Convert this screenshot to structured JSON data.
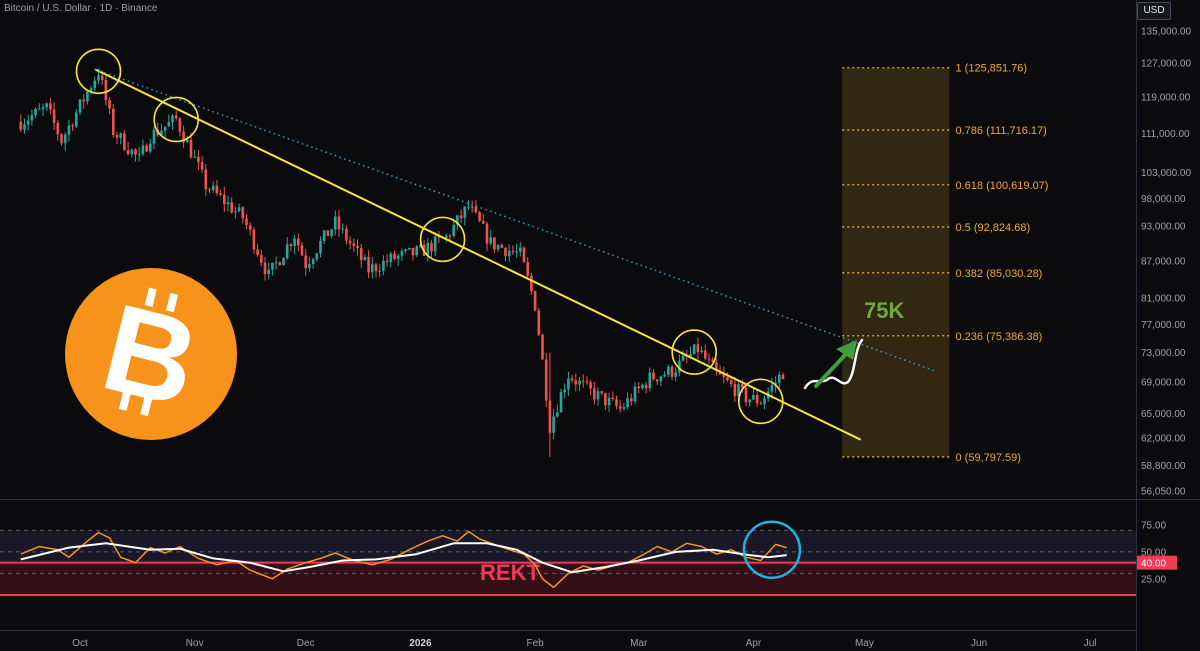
{
  "header": {
    "title": "Bitcoin / U.S. Dollar · 1D · Binance",
    "currency": "USD"
  },
  "colors": {
    "bull": "#26a69a",
    "bear": "#ef5350",
    "trend": "#f7e440",
    "dotted": "#2f9fc4",
    "fib": "#f0a92a",
    "rsi": "#f7931a",
    "rsi_ma": "#ffffff",
    "target": "#6fa93a",
    "bitcoin": "#f7931a"
  },
  "chart_data": [
    {
      "type": "candlestick",
      "title": "Bitcoin / U.S. Dollar · 1D · Binance",
      "y_axis_ticks": [
        "135,000.00",
        "127,000.00",
        "119,000.00",
        "111,000.00",
        "103,000.00",
        "98,000.00",
        "93,000.00",
        "87,000.00",
        "81,000.00",
        "77,000.00",
        "73,000.00",
        "69,000.00",
        "65,000.00",
        "62,000.00",
        "58,800.00",
        "56,050.00"
      ],
      "x_axis_ticks": [
        "Oct",
        "Nov",
        "Dec",
        "2026",
        "Feb",
        "Mar",
        "Apr",
        "May",
        "Jun",
        "Jul"
      ],
      "log_scale": true,
      "ylim": [
        54500,
        140000
      ],
      "price_path": [
        [
          "2025-09-15",
          113500
        ],
        [
          "2025-09-22",
          116500
        ],
        [
          "2025-09-26",
          109500
        ],
        [
          "2025-10-01",
          117000
        ],
        [
          "2025-10-06",
          125000
        ],
        [
          "2025-10-10",
          111500
        ],
        [
          "2025-10-17",
          105500
        ],
        [
          "2025-10-20",
          110500
        ],
        [
          "2025-10-27",
          114000
        ],
        [
          "2025-11-04",
          100500
        ],
        [
          "2025-11-14",
          94500
        ],
        [
          "2025-11-21",
          84500
        ],
        [
          "2025-11-28",
          91500
        ],
        [
          "2025-12-01",
          86500
        ],
        [
          "2025-12-09",
          93500
        ],
        [
          "2025-12-18",
          85500
        ],
        [
          "2025-12-25",
          87500
        ],
        [
          "2026-01-01",
          88500
        ],
        [
          "2026-01-08",
          91000
        ],
        [
          "2026-01-14",
          96500
        ],
        [
          "2026-01-20",
          90000
        ],
        [
          "2026-01-28",
          88000
        ],
        [
          "2026-02-01",
          80000
        ],
        [
          "2026-02-05",
          63500
        ],
        [
          "2026-02-10",
          70000
        ],
        [
          "2026-02-15",
          68000
        ],
        [
          "2026-02-24",
          65500
        ],
        [
          "2026-03-04",
          69500
        ],
        [
          "2026-03-10",
          70500
        ],
        [
          "2026-03-17",
          73500
        ],
        [
          "2026-03-22",
          70000
        ],
        [
          "2026-03-30",
          67000
        ],
        [
          "2026-04-03",
          66500
        ],
        [
          "2026-04-07",
          69000
        ],
        [
          "2026-04-10",
          71000
        ]
      ],
      "circled_touch_points": [
        "2025-10-06",
        "2025-10-27",
        "2026-01-07",
        "2026-03-16",
        "2026-04-03"
      ],
      "trendlines": [
        {
          "style": "solid",
          "from": [
            "2025-10-05",
            125500
          ],
          "to": [
            "2026-04-30",
            61800
          ]
        },
        {
          "style": "dotted",
          "from": [
            "2025-10-05",
            125500
          ],
          "to": [
            "2026-05-20",
            70500
          ]
        }
      ],
      "fibonacci": {
        "levels": [
          {
            "label": "1 (125,851.76)",
            "value": 125851.76
          },
          {
            "label": "0.786 (111,716.17)",
            "value": 111716.17
          },
          {
            "label": "0.618 (100,619.07)",
            "value": 100619.07
          },
          {
            "label": "0.5 (92,824.68)",
            "value": 92824.68
          },
          {
            "label": "0.382 (85,030.28)",
            "value": 85030.28
          },
          {
            "label": "0.236 (75,386.38)",
            "value": 75386.38
          },
          {
            "label": "0 (59,797.59)",
            "value": 59797.59
          }
        ],
        "x_range": [
          "2026-04-25",
          "2026-05-24"
        ]
      },
      "annotation": {
        "text": "75K",
        "value": 75000
      }
    },
    {
      "type": "line",
      "name": "RSI",
      "y_axis_ticks": [
        "75.00",
        "50.00",
        "25.00"
      ],
      "ylim": [
        5,
        85
      ],
      "bands": [
        70,
        30
      ],
      "highlight_value": 40,
      "highlight_label": "40.00",
      "rekt_zone": [
        10,
        40
      ],
      "zone_label": "REKT",
      "rsi_path": [
        [
          "2025-09-15",
          48
        ],
        [
          "2025-09-20",
          55
        ],
        [
          "2025-09-25",
          52
        ],
        [
          "2025-09-28",
          45
        ],
        [
          "2025-10-03",
          60
        ],
        [
          "2025-10-06",
          68
        ],
        [
          "2025-10-09",
          63
        ],
        [
          "2025-10-12",
          45
        ],
        [
          "2025-10-16",
          40
        ],
        [
          "2025-10-20",
          54
        ],
        [
          "2025-10-24",
          49
        ],
        [
          "2025-10-28",
          55
        ],
        [
          "2025-11-02",
          44
        ],
        [
          "2025-11-07",
          38
        ],
        [
          "2025-11-12",
          42
        ],
        [
          "2025-11-16",
          33
        ],
        [
          "2025-11-19",
          29
        ],
        [
          "2025-11-22",
          25
        ],
        [
          "2025-11-26",
          34
        ],
        [
          "2025-12-01",
          40
        ],
        [
          "2025-12-05",
          44
        ],
        [
          "2025-12-09",
          49
        ],
        [
          "2025-12-14",
          42
        ],
        [
          "2025-12-19",
          38
        ],
        [
          "2025-12-24",
          43
        ],
        [
          "2025-12-29",
          52
        ],
        [
          "2026-01-03",
          60
        ],
        [
          "2026-01-07",
          65
        ],
        [
          "2026-01-11",
          60
        ],
        [
          "2026-01-14",
          69
        ],
        [
          "2026-01-17",
          62
        ],
        [
          "2026-01-21",
          57
        ],
        [
          "2026-01-25",
          52
        ],
        [
          "2026-01-29",
          48
        ],
        [
          "2026-02-01",
          38
        ],
        [
          "2026-02-03",
          25
        ],
        [
          "2026-02-06",
          17
        ],
        [
          "2026-02-10",
          30
        ],
        [
          "2026-02-14",
          37
        ],
        [
          "2026-02-18",
          33
        ],
        [
          "2026-02-22",
          37
        ],
        [
          "2026-02-26",
          40
        ],
        [
          "2026-03-02",
          47
        ],
        [
          "2026-03-06",
          55
        ],
        [
          "2026-03-10",
          50
        ],
        [
          "2026-03-14",
          58
        ],
        [
          "2026-03-18",
          55
        ],
        [
          "2026-03-22",
          48
        ],
        [
          "2026-03-26",
          52
        ],
        [
          "2026-03-30",
          45
        ],
        [
          "2026-04-03",
          42
        ],
        [
          "2026-04-07",
          57
        ],
        [
          "2026-04-10",
          54
        ]
      ],
      "ma_path": [
        [
          "2025-09-15",
          43
        ],
        [
          "2025-09-28",
          54
        ],
        [
          "2025-10-08",
          58
        ],
        [
          "2025-10-20",
          52
        ],
        [
          "2025-10-28",
          53
        ],
        [
          "2025-11-06",
          44
        ],
        [
          "2025-11-16",
          40
        ],
        [
          "2025-11-25",
          32
        ],
        [
          "2025-12-02",
          36
        ],
        [
          "2025-12-11",
          42
        ],
        [
          "2025-12-20",
          43
        ],
        [
          "2025-12-31",
          48
        ],
        [
          "2026-01-10",
          58
        ],
        [
          "2026-01-19",
          58
        ],
        [
          "2026-01-27",
          52
        ],
        [
          "2026-02-03",
          40
        ],
        [
          "2026-02-11",
          31
        ],
        [
          "2026-02-20",
          36
        ],
        [
          "2026-03-01",
          42
        ],
        [
          "2026-03-11",
          50
        ],
        [
          "2026-03-21",
          52
        ],
        [
          "2026-03-31",
          47
        ],
        [
          "2026-04-05",
          45
        ],
        [
          "2026-04-10",
          47
        ]
      ],
      "circled_point": "2026-04-06"
    }
  ]
}
